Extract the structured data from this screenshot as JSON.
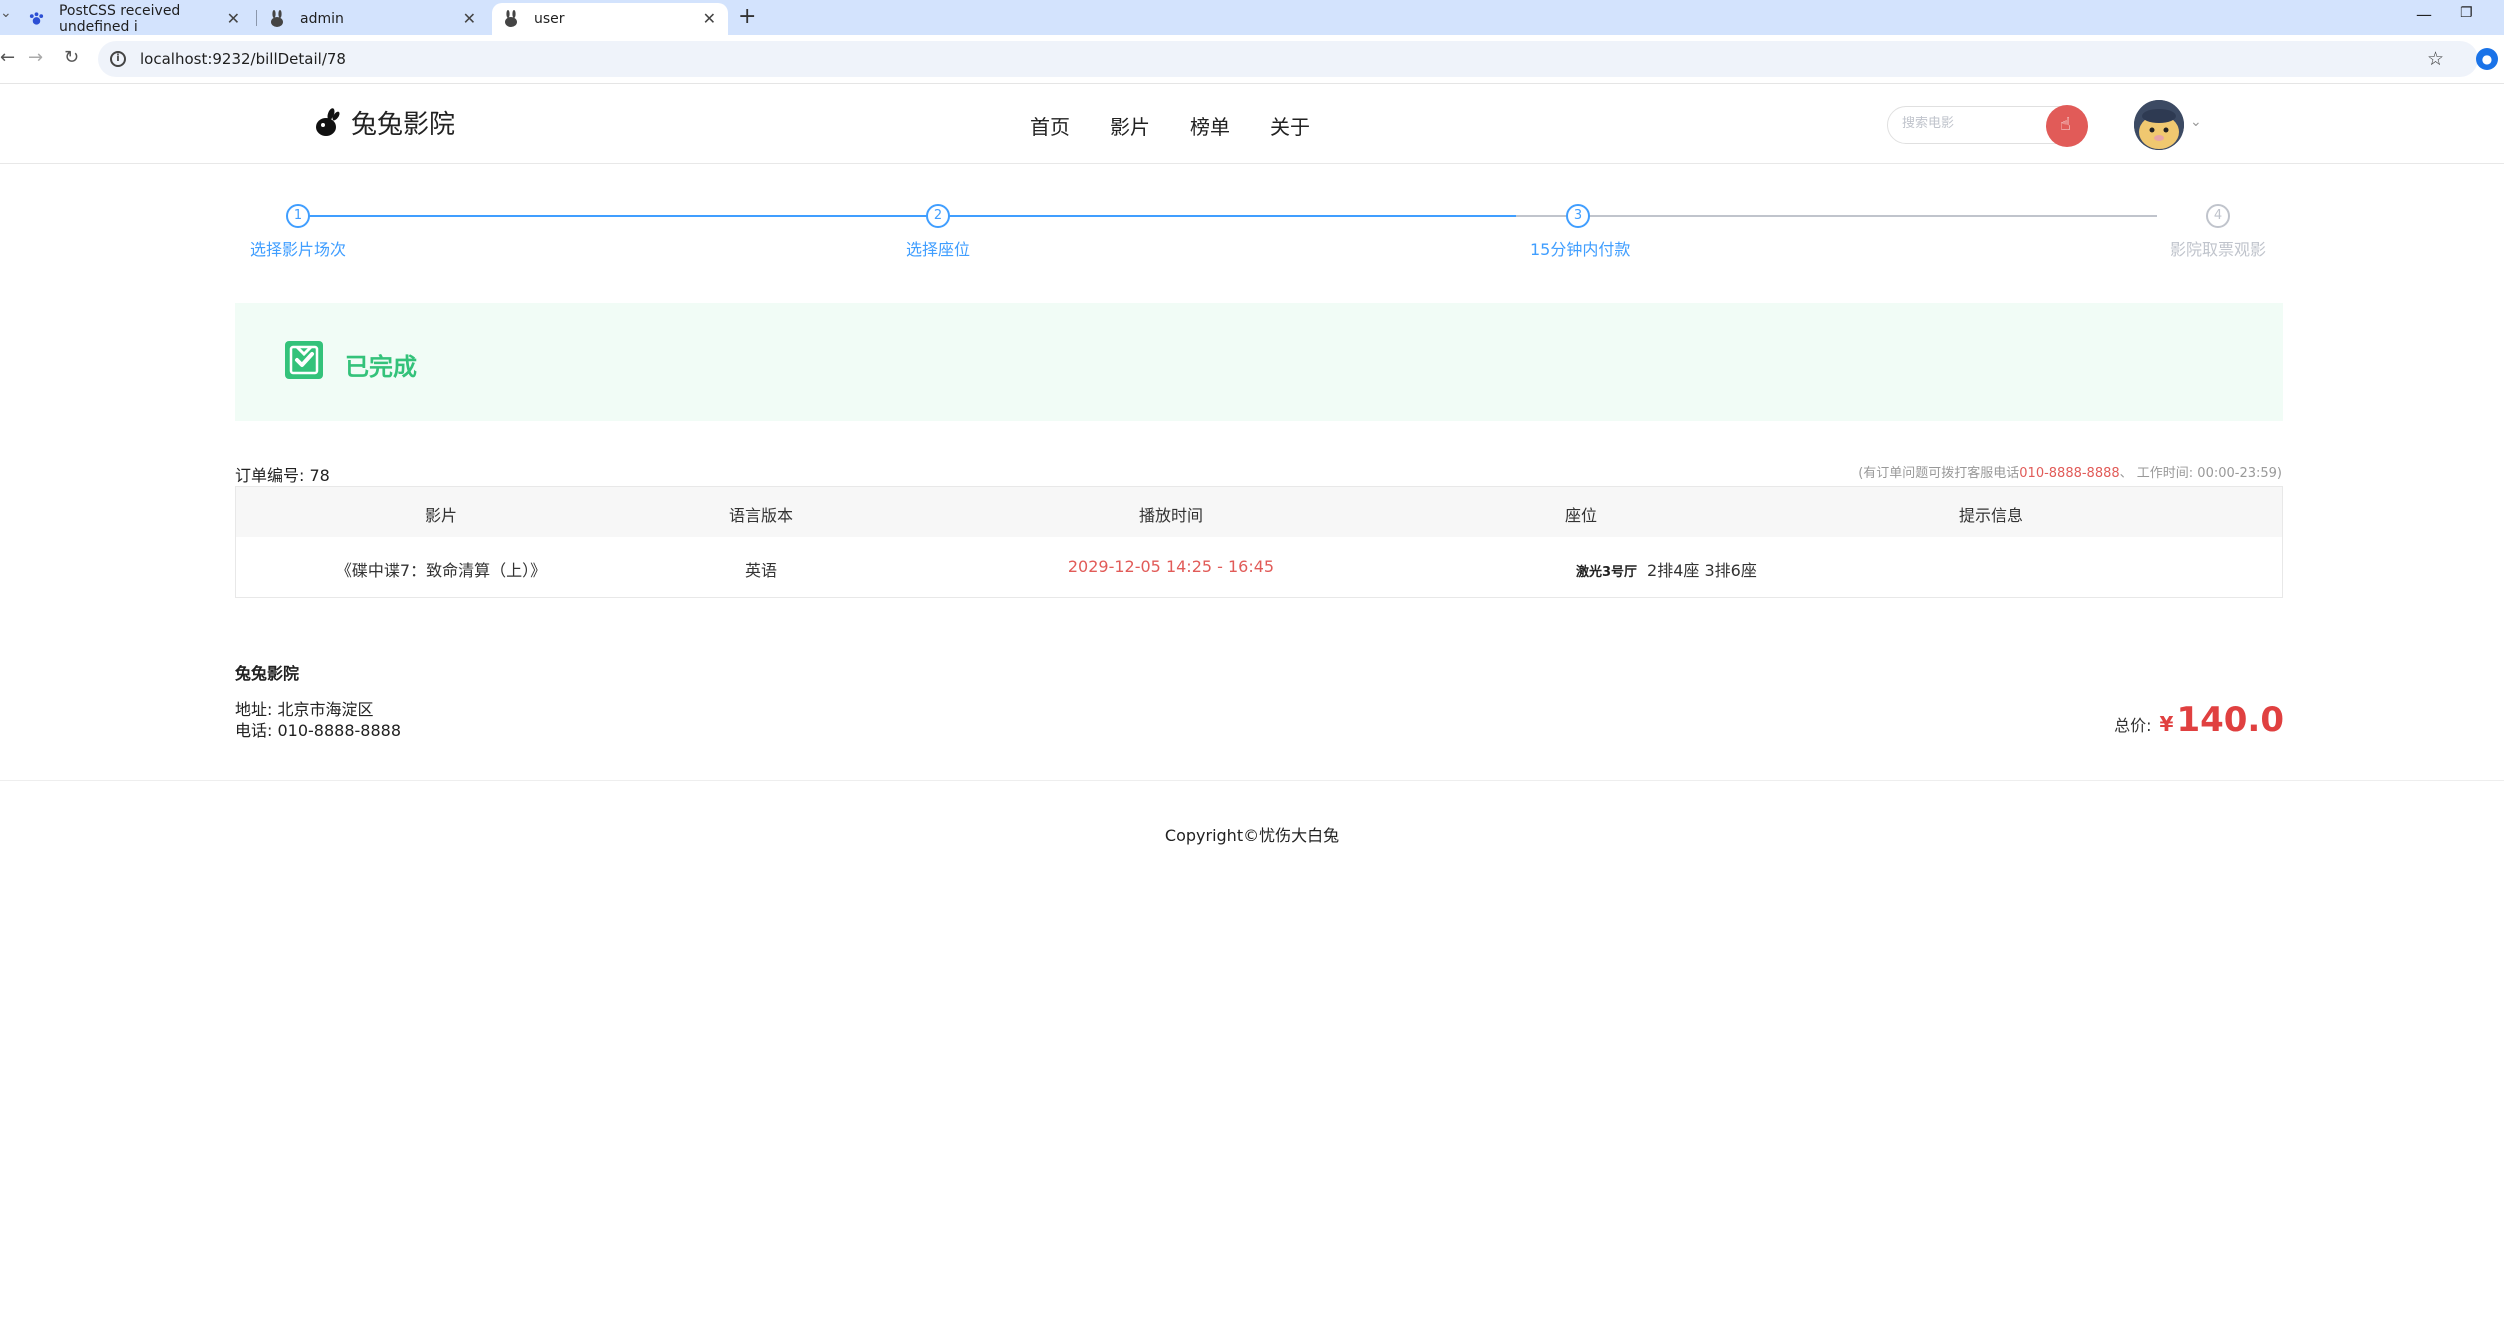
{
  "browser": {
    "tabs": [
      {
        "label": "PostCSS received undefined i"
      },
      {
        "label": "admin"
      },
      {
        "label": "user"
      }
    ],
    "url": "localhost:9232/billDetail/78"
  },
  "header": {
    "logo": "兔兔影院",
    "nav": [
      "首页",
      "影片",
      "榜单",
      "关于"
    ],
    "search_placeholder": "搜索电影"
  },
  "steps": [
    {
      "number": "1",
      "label": "选择影片场次",
      "state": "done"
    },
    {
      "number": "2",
      "label": "选择座位",
      "state": "done"
    },
    {
      "number": "3",
      "label": "15分钟内付款",
      "state": "done"
    },
    {
      "number": "4",
      "label": "影院取票观影",
      "state": "pending"
    }
  ],
  "status": {
    "text": "已完成"
  },
  "order": {
    "number_label": "订单编号: 78",
    "note_prefix": "(有订单问题可拨打客服电话",
    "note_phone": "010-8888-8888",
    "note_suffix": "、 工作时间: 00:00-23:59)",
    "columns": [
      "影片",
      "语言版本",
      "播放时间",
      "座位",
      "提示信息"
    ],
    "row": {
      "movie": "《碟中谍7：致命清算（上）》",
      "language": "英语",
      "time": "2029-12-05 14:25 - 16:45",
      "hall": "激光3号厅",
      "seats": "2排4座 3排6座",
      "tips": ""
    }
  },
  "cinema": {
    "name": "兔兔影院",
    "address": "地址: 北京市海淀区",
    "phone": "电话: 010-8888-8888"
  },
  "total": {
    "label": "总价:",
    "currency": "¥",
    "value": "140.0"
  },
  "footer": {
    "copyright": "Copyright©忧伤大白兔"
  }
}
